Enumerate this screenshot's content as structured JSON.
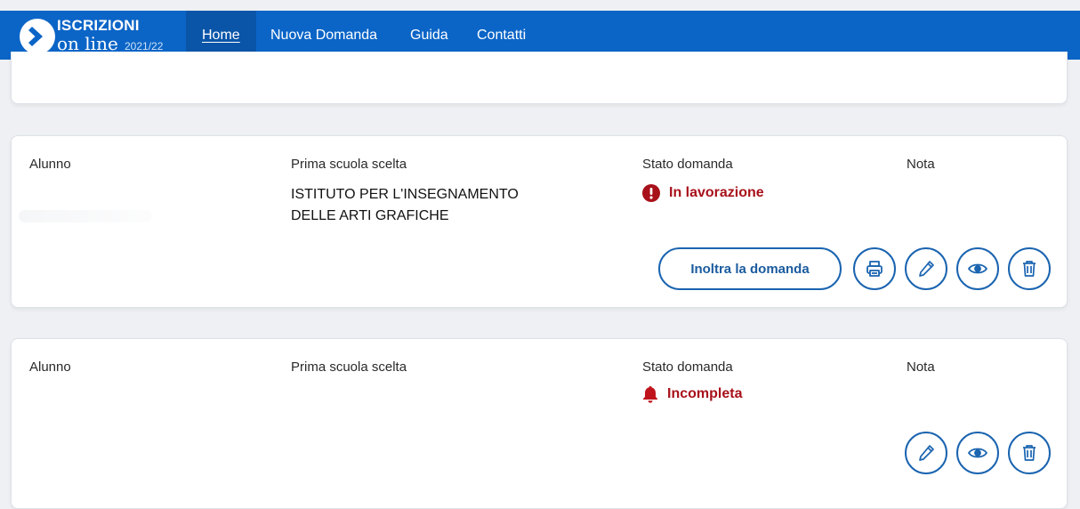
{
  "header": {
    "logo_title": "ISCRIZIONI",
    "logo_sub": "on line",
    "logo_year": "2021/22",
    "nav": [
      {
        "label": "Home",
        "active": true
      },
      {
        "label": "Nuova Domanda",
        "active": false
      },
      {
        "label": "Guida",
        "active": false
      },
      {
        "label": "Contatti",
        "active": false
      }
    ]
  },
  "applications": [
    {
      "col_student": "Alunno",
      "col_school": "Prima scuola scelta",
      "col_status": "Stato domanda",
      "col_note": "Nota",
      "school_line1": "ISTITUTO PER L'INSEGNAMENTO",
      "school_line2": "DELLE ARTI GRAFICHE",
      "status": "In lavorazione",
      "status_icon": "alert-circle-icon",
      "forward_label": "Inoltra la domanda",
      "actions": [
        "print-icon",
        "pencil-icon",
        "eye-icon",
        "trash-icon"
      ]
    },
    {
      "col_student": "Alunno",
      "col_school": "Prima scuola scelta",
      "col_status": "Stato domanda",
      "col_note": "Nota",
      "status": "Incompleta",
      "status_icon": "bell-icon",
      "actions": [
        "pencil-icon",
        "eye-icon",
        "trash-icon"
      ]
    }
  ],
  "colors": {
    "brand_blue": "#0b65c7",
    "button_blue": "#1a64b0",
    "status_red": "#a8111a"
  }
}
